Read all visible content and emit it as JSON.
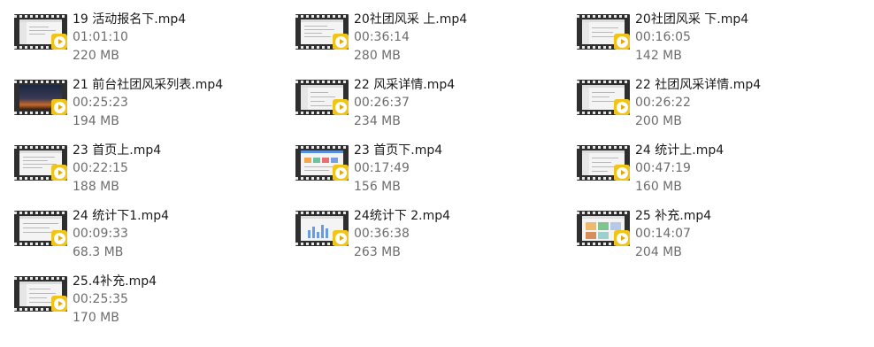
{
  "files": [
    {
      "name": "19 活动报名下.mp4",
      "duration": "01:01:10",
      "size": "220 MB",
      "thumb": "doc"
    },
    {
      "name": "20社团风采 上.mp4",
      "duration": "00:36:14",
      "size": "280 MB",
      "thumb": "doc"
    },
    {
      "name": "20社团风采 下.mp4",
      "duration": "00:16:05",
      "size": "142 MB",
      "thumb": "doc"
    },
    {
      "name": "21 前台社团风采列表.mp4",
      "duration": "00:25:23",
      "size": "194 MB",
      "thumb": "night"
    },
    {
      "name": "22 风采详情.mp4",
      "duration": "00:26:37",
      "size": "234 MB",
      "thumb": "doc"
    },
    {
      "name": "22 社团风采详情.mp4",
      "duration": "00:26:22",
      "size": "200 MB",
      "thumb": "doc"
    },
    {
      "name": "23 首页上.mp4",
      "duration": "00:22:15",
      "size": "188 MB",
      "thumb": "doc"
    },
    {
      "name": "23 首页下.mp4",
      "duration": "00:17:49",
      "size": "156 MB",
      "thumb": "colorful"
    },
    {
      "name": "24 统计上.mp4",
      "duration": "00:47:19",
      "size": "160 MB",
      "thumb": "doc"
    },
    {
      "name": "24 统计下1.mp4",
      "duration": "00:09:33",
      "size": "68.3 MB",
      "thumb": "doc"
    },
    {
      "name": "24统计下 2.mp4",
      "duration": "00:36:38",
      "size": "263 MB",
      "thumb": "chart"
    },
    {
      "name": "25 补充.mp4",
      "duration": "00:14:07",
      "size": "204 MB",
      "thumb": "colorful"
    },
    {
      "name": "25.4补充.mp4",
      "duration": "00:25:35",
      "size": "170 MB",
      "thumb": "doc"
    }
  ]
}
